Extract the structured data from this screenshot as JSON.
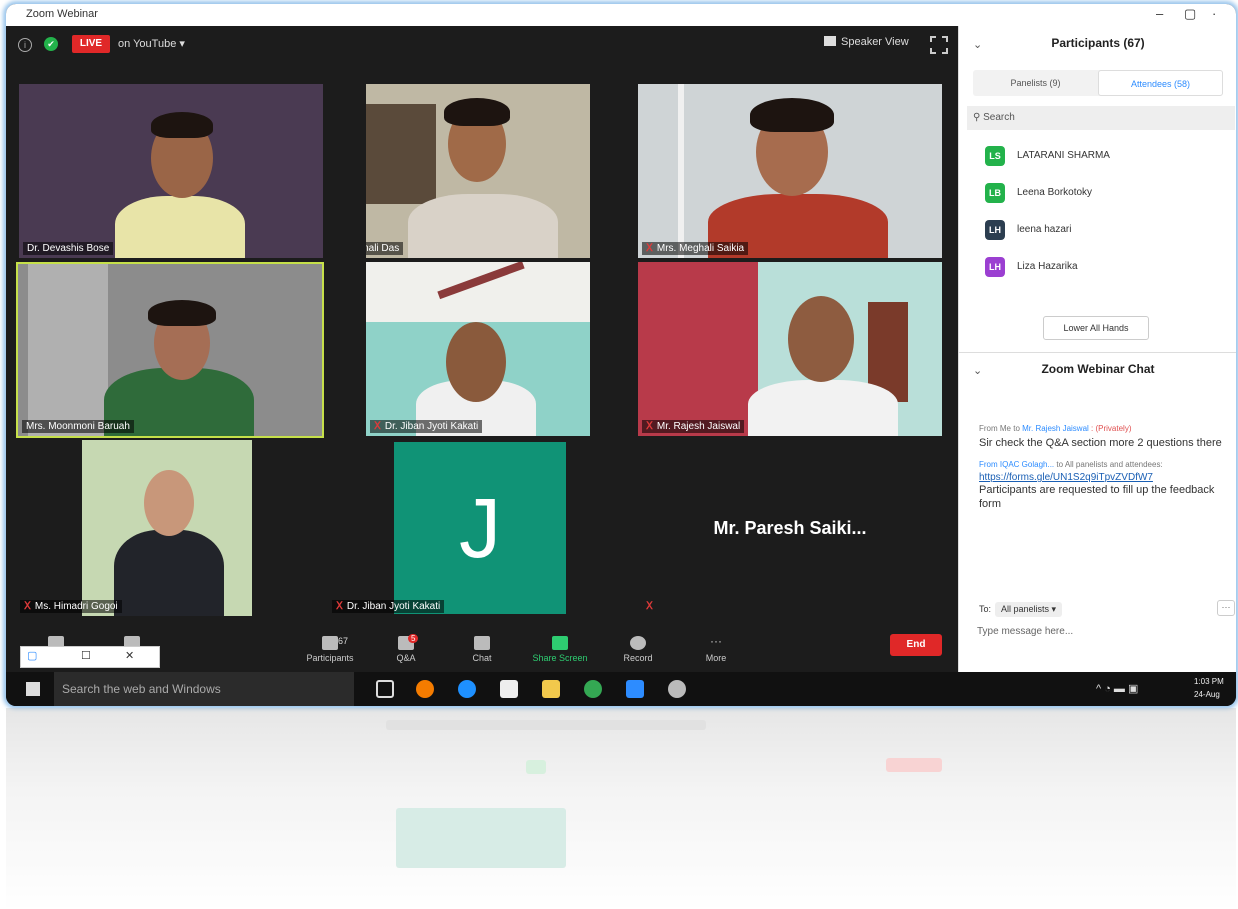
{
  "window": {
    "title": "Zoom Webinar",
    "min": "–",
    "max": "▢",
    "close": "·"
  },
  "topbar": {
    "live": "LIVE",
    "youtube": "on YouTube ▾",
    "speaker_view": "Speaker View"
  },
  "tiles": [
    {
      "name": "Dr. Devashis Bose",
      "muted": false,
      "highlighted": false
    },
    {
      "name": "Sonali Das",
      "muted": true,
      "highlighted": false
    },
    {
      "name": "Mrs. Meghali Saikia",
      "muted": true,
      "highlighted": false
    },
    {
      "name": "Mrs. Moonmoni Baruah",
      "muted": false,
      "highlighted": true
    },
    {
      "name": "Dr. Jiban Jyoti Kakati",
      "muted": true,
      "highlighted": false
    },
    {
      "name": "Mr. Rajesh Jaiswal",
      "muted": true,
      "highlighted": false
    },
    {
      "name": "Ms. Himadri Gogoi",
      "muted": true,
      "highlighted": false
    },
    {
      "name": "Dr. Jiban Jyoti Kakati",
      "muted": true,
      "highlighted": false,
      "initial": "J"
    },
    {
      "name": "Mr. Paresh Saiki...",
      "muted": true,
      "highlighted": false
    }
  ],
  "toolbar": {
    "participants_count": "67",
    "participants": "Participants",
    "qa": "Q&A",
    "qa_badge": "5",
    "chat": "Chat",
    "share": "Share Screen",
    "record": "Record",
    "more": "More",
    "end": "End",
    "mini": {
      "a": "▢",
      "b": "☐",
      "c": "✕"
    }
  },
  "panel": {
    "title": "Participants (67)",
    "tab_panelists": "Panelists (9)",
    "tab_attendees": "Attendees (58)",
    "search": "Search",
    "attendees": [
      {
        "initials": "LS",
        "name": "LATARANI SHARMA",
        "color": "#23b24b"
      },
      {
        "initials": "LB",
        "name": "Leena Borkotoky",
        "color": "#23b24b"
      },
      {
        "initials": "LH",
        "name": "leena hazari",
        "color": "#2c3e50"
      },
      {
        "initials": "LH",
        "name": "Liza Hazarika",
        "color": "#9b3fd1"
      }
    ],
    "lower_hands": "Lower All Hands",
    "chat_title": "Zoom Webinar Chat",
    "chat": [
      {
        "from": "From Me to ",
        "to": "Mr. Rajesh Jaiswal",
        "tag": " : (Privately)",
        "text": "Sir check the Q&A section more 2 questions there"
      },
      {
        "from": "From IQAC Golagh...",
        "to": " to All panelists and attendees",
        "tag": ":",
        "link": "https://forms.gle/UN1S2q9iTpvZVDfW7",
        "text": "Participants are requested to fill up the feedback form"
      }
    ],
    "to_label": "To:",
    "to_target": "All panelists ▾",
    "input_placeholder": "Type message here..."
  },
  "taskbar": {
    "search": "Search the web and Windows",
    "time": "1:03 PM",
    "date": "24-Aug"
  }
}
